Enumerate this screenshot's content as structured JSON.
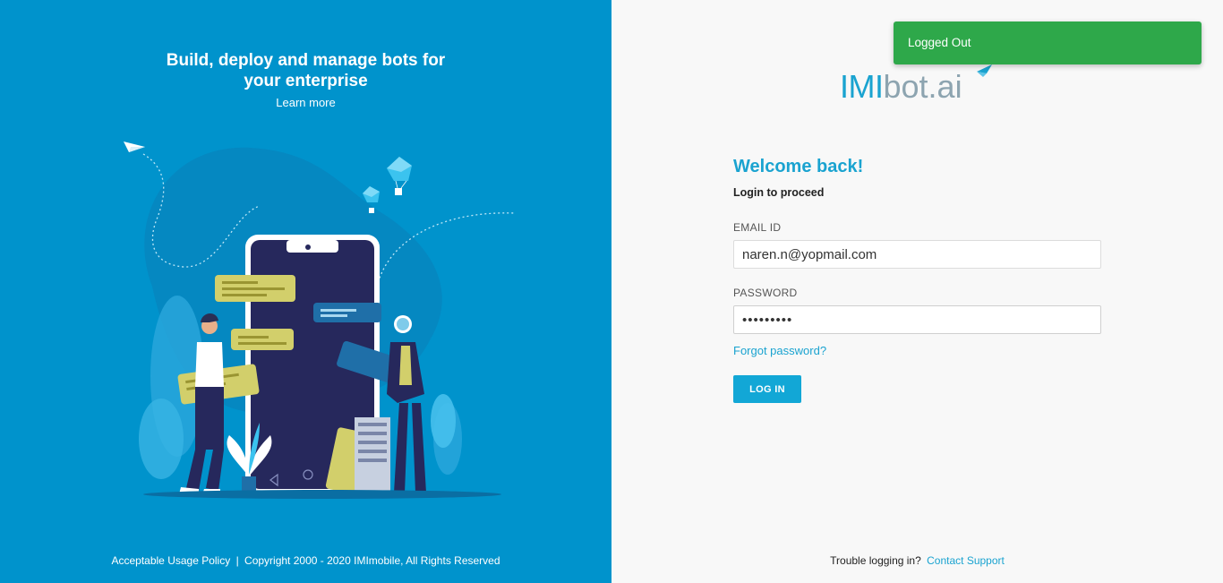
{
  "hero": {
    "title_line1": "Build, deploy and manage bots for",
    "title_line2": "your enterprise",
    "learn_more": "Learn more"
  },
  "left_footer": {
    "policy_link": "Acceptable Usage Policy",
    "copyright": "Copyright 2000 - 2020 IMImobile, All Rights Reserved"
  },
  "logo": {
    "brand_part1": "IMI",
    "brand_part2": "bot.ai"
  },
  "login": {
    "welcome": "Welcome back!",
    "subtitle": "Login to proceed",
    "email_label": "EMAIL ID",
    "email_value": "naren.n@yopmail.com",
    "password_label": "PASSWORD",
    "password_value": "•••••••••",
    "forgot": "Forgot password?",
    "login_button": "LOG IN"
  },
  "right_footer": {
    "trouble_text": "Trouble logging in?",
    "support_link": "Contact Support"
  },
  "toast": {
    "message": "Logged Out",
    "color": "#2ea84a"
  },
  "colors": {
    "left_panel_bg": "#0093cc",
    "accent": "#1aa3d0",
    "right_panel_bg": "#f8f8f8"
  }
}
